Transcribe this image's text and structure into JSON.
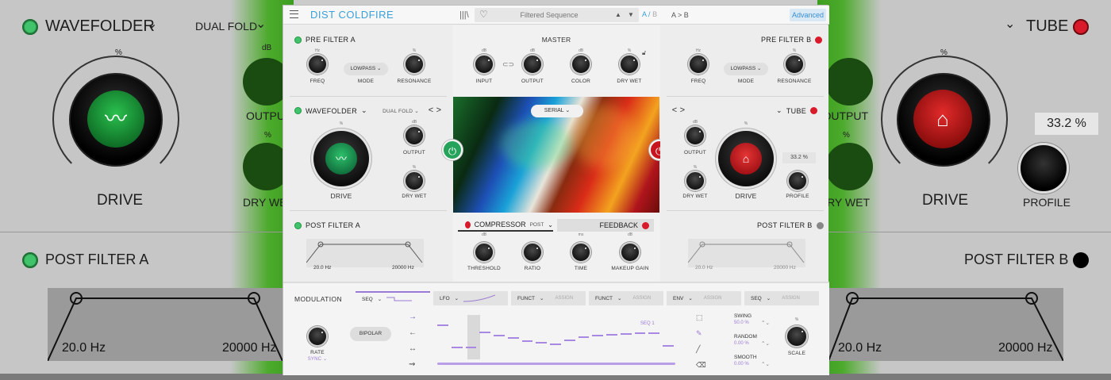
{
  "background": {
    "left": {
      "module_name": "WAVEFOLDER",
      "mode": "DUAL FOLD",
      "drive_label": "DRIVE",
      "percent": "%",
      "output_label": "OUTPUT",
      "db": "dB",
      "drywet_label": "DRY WET",
      "post_filter": "POST FILTER A",
      "hz_low": "20.0 Hz",
      "hz_high": "20000 Hz"
    },
    "right": {
      "module_name": "TUBE",
      "drive_label": "DRIVE",
      "percent": "%",
      "output_label": "OUTPUT",
      "drywet_label": "DRY WET",
      "profile_label": "PROFILE",
      "profile_value": "33.2 %",
      "post_filter": "POST FILTER B",
      "hz_low": "20.0 Hz",
      "hz_high": "20000 Hz"
    }
  },
  "topbar": {
    "title": "DIST COLDFIRE",
    "preset_name": "Filtered Sequence",
    "ab_a": "A",
    "ab_sep": "/",
    "ab_b": "B",
    "a_to_b": "A > B",
    "advanced": "Advanced"
  },
  "pre_filter_a": {
    "title": "PRE FILTER A",
    "freq": "FREQ",
    "freq_unit": "Hz",
    "mode_value": "LOWPASS",
    "mode": "MODE",
    "resonance": "RESONANCE",
    "res_unit": "%"
  },
  "wavefolder": {
    "title": "WAVEFOLDER",
    "mode": "DUAL FOLD",
    "nav": "< >",
    "drive": "DRIVE",
    "drive_unit": "%",
    "output": "OUTPUT",
    "output_unit": "dB",
    "drywet": "DRY WET",
    "drywet_unit": "%"
  },
  "post_filter_a": {
    "title": "POST FILTER A",
    "hz_low": "20.0 Hz",
    "hz_high": "20000 Hz"
  },
  "master": {
    "title": "MASTER",
    "input": "INPUT",
    "input_unit": "dB",
    "output": "OUTPUT",
    "output_unit": "dB",
    "color": "COLOR",
    "color_unit": "dB",
    "drywet": "DRY WET",
    "drywet_unit": "%",
    "routing": "SERIAL"
  },
  "compressor": {
    "title": "COMPRESSOR",
    "mode": "POST",
    "threshold": "THRESHOLD",
    "threshold_unit": "dB",
    "ratio": "RATIO",
    "time": "TIME",
    "time_unit": "ms",
    "makeup": "MAKEUP GAIN",
    "makeup_unit": "dB",
    "feedback": "FEEDBACK"
  },
  "pre_filter_b": {
    "title": "PRE FILTER B",
    "freq": "FREQ",
    "freq_unit": "Hz",
    "mode_value": "LOWPASS",
    "mode": "MODE",
    "resonance": "RESONANCE",
    "res_unit": "%"
  },
  "tube": {
    "title": "TUBE",
    "nav": "< >",
    "drive": "DRIVE",
    "drive_unit": "%",
    "output": "OUTPUT",
    "output_unit": "dB",
    "drywet": "DRY WET",
    "drywet_unit": "%",
    "profile": "PROFILE",
    "profile_value": "33.2 %"
  },
  "post_filter_b": {
    "title": "POST FILTER B",
    "hz_low": "20.0 Hz",
    "hz_high": "20000 Hz"
  },
  "modulation": {
    "title": "MODULATION",
    "tabs": [
      {
        "label": "SEQ",
        "assign": ""
      },
      {
        "label": "LFO",
        "assign": ""
      },
      {
        "label": "FUNCT",
        "assign": "ASSIGN"
      },
      {
        "label": "FUNCT",
        "assign": "ASSIGN"
      },
      {
        "label": "ENV",
        "assign": "ASSIGN"
      },
      {
        "label": "SEQ",
        "assign": "ASSIGN"
      }
    ],
    "rate": "RATE",
    "sync": "SYNC",
    "bipolar": "BIPOLAR",
    "seq_label": "SEQ 1",
    "swing": "SWING",
    "swing_value": "50.0 %",
    "random": "RANDOM",
    "random_value": "0.00 %",
    "smooth": "SMOOTH",
    "smooth_value": "0.00 %",
    "scale": "SCALE",
    "scale_unit": "%",
    "steps": [
      0.78,
      0.28,
      0.28,
      0.63,
      0.56,
      0.5,
      0.43,
      0.4,
      0.35,
      0.45,
      0.51,
      0.56,
      0.58,
      0.59,
      0.61,
      0.6,
      0.33
    ]
  },
  "colors": {
    "accent": "#3aa0d8",
    "mod_accent": "#9a7ad4",
    "led_green": "#41c36b",
    "led_red": "#d91a2a"
  }
}
